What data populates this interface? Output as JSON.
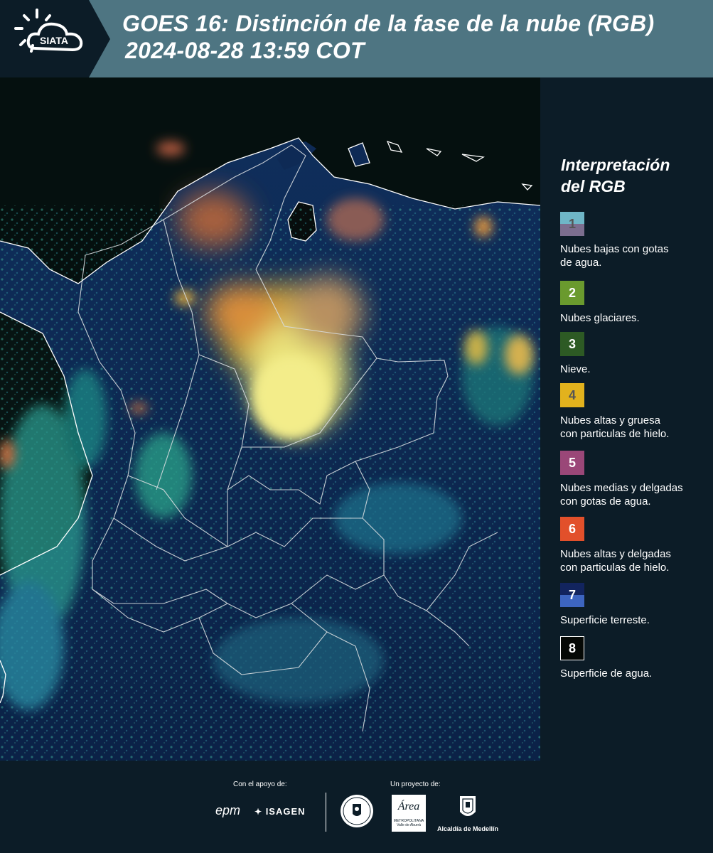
{
  "header": {
    "title_line1": "GOES 16: Distinción de la fase de la nube (RGB)",
    "title_line2": "2024-08-28 13:59 COT",
    "logo_text": "SIATA"
  },
  "legend": {
    "title_line1": "Interpretación",
    "title_line2": "del RGB",
    "items": [
      {
        "number": "1",
        "label_line1": "Nubes bajas con gotas",
        "label_line2": "de agua.",
        "color_top": "#6fb6c7",
        "color_bottom": "#7c6e8f",
        "number_color": "#555555"
      },
      {
        "number": "2",
        "label_line1": "Nubes glaciares.",
        "label_line2": "",
        "color_top": "#6a9a2e",
        "color_bottom": "#6a9a2e",
        "number_color": "#ffffff"
      },
      {
        "number": "3",
        "label_line1": "Nieve.",
        "label_line2": "",
        "color_top": "#2d5a24",
        "color_bottom": "#2d5a24",
        "number_color": "#ffffff"
      },
      {
        "number": "4",
        "label_line1": "Nubes altas y gruesa",
        "label_line2": "con particulas de hielo.",
        "color_top": "#e2b21d",
        "color_bottom": "#e2b21d",
        "number_color": "#555555"
      },
      {
        "number": "5",
        "label_line1": "Nubes medias y delgadas",
        "label_line2": "con gotas de agua.",
        "color_top": "#9a4778",
        "color_bottom": "#9a4778",
        "number_color": "#ffffff"
      },
      {
        "number": "6",
        "label_line1": "Nubes altas y delgadas",
        "label_line2": "con particulas de hielo.",
        "color_top": "#e2502b",
        "color_bottom": "#e2502b",
        "number_color": "#ffffff"
      },
      {
        "number": "7",
        "label_line1": "Superficie terreste.",
        "label_line2": "",
        "color_top": "#12245e",
        "color_bottom": "#3d65c0",
        "number_color": "#ffffff"
      },
      {
        "number": "8",
        "label_line1": "Superficie de agua.",
        "label_line2": "",
        "color_top": "#050805",
        "color_bottom": "#050805",
        "number_color": "#ffffff"
      }
    ]
  },
  "footer": {
    "support_label": "Con el apoyo de:",
    "project_label": "Un proyecto de:",
    "sponsor1": "epm",
    "sponsor2": "ISAGEN",
    "partner_area_line1": "METROPOLITANA",
    "partner_area_line2": "Valle de Aburrá",
    "partner_area_script": "Área",
    "partner_alcaldia": "Alcaldía de Medellín"
  },
  "colors": {
    "header_bg": "#4e7582",
    "panel_bg": "#0c1c27"
  }
}
